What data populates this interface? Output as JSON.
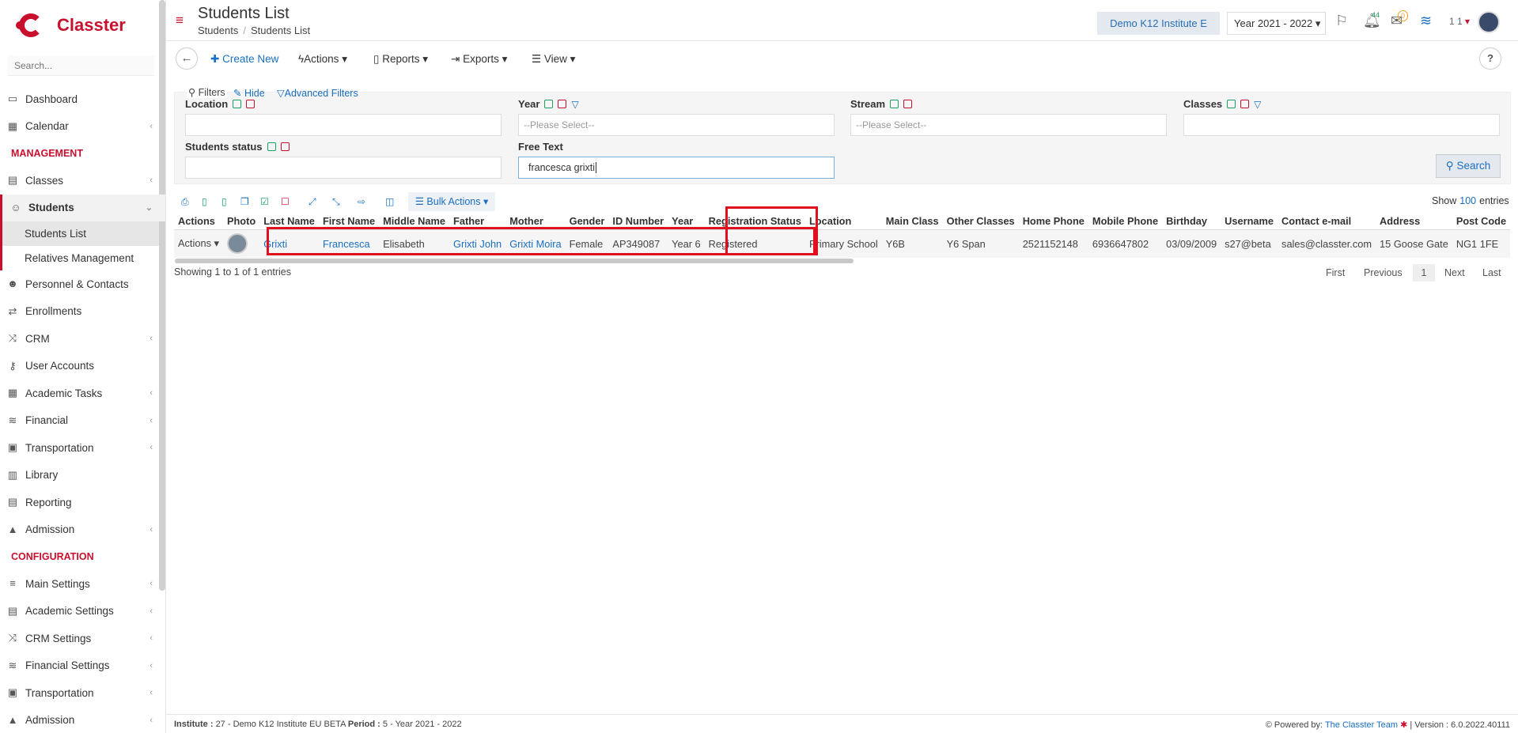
{
  "brand": {
    "name": "Classter",
    "color": "#c8102e"
  },
  "sidebar": {
    "search_placeholder": "Search...",
    "items_top": [
      {
        "label": "Dashboard",
        "icon": "laptop-icon",
        "glyph": "▭"
      },
      {
        "label": "Calendar",
        "icon": "calendar-icon",
        "glyph": "▦"
      }
    ],
    "management_heading": "MANAGEMENT",
    "items_management": [
      {
        "label": "Classes",
        "icon": "classes-icon",
        "glyph": "▤"
      },
      {
        "label": "Students",
        "icon": "students-icon",
        "glyph": "☺"
      }
    ],
    "students_sub": [
      {
        "label": "Students List"
      },
      {
        "label": "Relatives Management"
      }
    ],
    "items_management_2": [
      {
        "label": "Personnel & Contacts",
        "icon": "contacts-icon",
        "glyph": "☻"
      },
      {
        "label": "Enrollments",
        "icon": "enrollments-icon",
        "glyph": "⇄"
      },
      {
        "label": "CRM",
        "icon": "crm-icon",
        "glyph": "⤨"
      },
      {
        "label": "User Accounts",
        "icon": "key-icon",
        "glyph": "⚷"
      },
      {
        "label": "Academic Tasks",
        "icon": "tasks-icon",
        "glyph": "▦"
      },
      {
        "label": "Financial",
        "icon": "coins-icon",
        "glyph": "≋"
      },
      {
        "label": "Transportation",
        "icon": "bus-icon",
        "glyph": "▣"
      },
      {
        "label": "Library",
        "icon": "books-icon",
        "glyph": "▥"
      },
      {
        "label": "Reporting",
        "icon": "printer-icon",
        "glyph": "▤"
      },
      {
        "label": "Admission",
        "icon": "institution-icon",
        "glyph": "▲"
      }
    ],
    "configuration_heading": "CONFIGURATION",
    "items_config": [
      {
        "label": "Main Settings",
        "icon": "sliders-icon",
        "glyph": "≡"
      },
      {
        "label": "Academic Settings",
        "icon": "academic-icon",
        "glyph": "▤"
      },
      {
        "label": "CRM Settings",
        "icon": "crm-icon",
        "glyph": "⤨"
      },
      {
        "label": "Financial Settings",
        "icon": "coins-icon",
        "glyph": "≋"
      },
      {
        "label": "Transportation",
        "icon": "bus-icon",
        "glyph": "▣"
      },
      {
        "label": "Admission",
        "icon": "institution-icon",
        "glyph": "▲"
      }
    ]
  },
  "header": {
    "title": "Students List",
    "breadcrumb": [
      "Students",
      "Students List"
    ],
    "institute": "Demo K12 Institute E",
    "year": "Year 2021 - 2022",
    "notifications_count": "44",
    "messages_count": "0",
    "user_num": "1 1"
  },
  "toolbar": {
    "create_new": "Create New",
    "actions": "Actions",
    "reports": "Reports",
    "exports": "Exports",
    "view": "View",
    "help": "?"
  },
  "filters": {
    "title": "Filters",
    "hide": "Hide",
    "advanced": "Advanced Filters",
    "location_label": "Location",
    "year_label": "Year",
    "year_placeholder": "--Please Select--",
    "stream_label": "Stream",
    "stream_placeholder": "--Please Select--",
    "classes_label": "Classes",
    "status_label": "Students status",
    "free_text_label": "Free Text",
    "free_text_value": "francesca grixti",
    "search_btn": "Search"
  },
  "table_tools": {
    "bulk_actions": "Bulk Actions",
    "show_label": "Show",
    "show_count": "100",
    "entries_label": "entries"
  },
  "table": {
    "columns": [
      "Actions",
      "Photo",
      "Last Name",
      "First Name",
      "Middle Name",
      "Father",
      "Mother",
      "Gender",
      "ID Number",
      "Year",
      "Registration Status",
      "Location",
      "Main Class",
      "Other Classes",
      "Home Phone",
      "Mobile Phone",
      "Birthday",
      "Username",
      "Contact e-mail",
      "Address",
      "Post Code"
    ],
    "row": {
      "actions": "Actions",
      "last_name": "Grixti",
      "first_name": "Francesca",
      "middle_name": "Elisabeth",
      "father": "Grixti John",
      "mother": "Grixti Moira",
      "gender": "Female",
      "id_number": "AP349087",
      "year": "Year 6",
      "registration_status": "Registered",
      "location": "Primary School",
      "main_class": "Y6B",
      "other_classes": "Y6 Span",
      "home_phone": "2521152148",
      "mobile_phone": "6936647802",
      "birthday": "03/09/2009",
      "username": "s27@beta",
      "email": "sales@classter.com",
      "address": "15 Goose Gate",
      "post_code": "NG1 1FE"
    },
    "showing": "Showing 1 to 1 of 1 entries",
    "pager": {
      "first": "First",
      "previous": "Previous",
      "current": "1",
      "next": "Next",
      "last": "Last"
    }
  },
  "footer": {
    "institute_label": "Institute :",
    "institute_value": "27 - Demo K12 Institute EU BETA",
    "period_label": "Period :",
    "period_value": "5 - Year 2021 - 2022",
    "powered_by": "Powered by:",
    "team": "The Classter Team",
    "version": "| Version : 6.0.2022.40111"
  }
}
